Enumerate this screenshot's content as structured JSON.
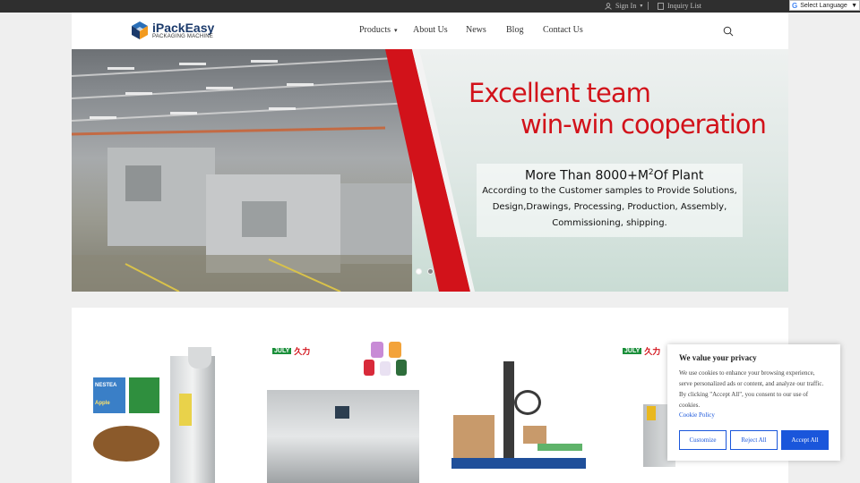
{
  "topbar": {
    "sign_in": "Sign In",
    "inquiry": "Inquiry List"
  },
  "language": {
    "label": "Select Language",
    "g": "G"
  },
  "header": {
    "brand": "iPackEasy",
    "brand_sub": "PACKAGING MACHINE",
    "nav": [
      "Products",
      "About Us",
      "News",
      "Blog",
      "Contact Us"
    ]
  },
  "hero": {
    "line1": "Excellent team",
    "line2": "win-win cooperation",
    "plant_prefix": "More Than 8000+M",
    "plant_sup": "2",
    "plant_suffix": "Of Plant",
    "desc1": "According to the Customer samples to Provide Solutions,",
    "desc2": "Design,Drawings, Processing, Production, Assembly,",
    "desc3": "Commissioning, shipping.",
    "slides": 2,
    "active_slide": 1
  },
  "products": {
    "card1": {
      "label1": "NESTEA",
      "label2": "Apple"
    },
    "brand_en": "JULY",
    "brand_cn": "久力"
  },
  "cookie": {
    "title": "We value your privacy",
    "body": "We use cookies to enhance your browsing experience, serve personalized ads or content, and analyze our traffic. By clicking \"Accept All\", you consent to our use of cookies.",
    "policy": "Cookie Policy",
    "customize": "Customize",
    "reject": "Reject All",
    "accept": "Accept All"
  },
  "colors": {
    "accent_red": "#d2121a",
    "link_blue": "#1a56db",
    "topbar": "#2f2f2f",
    "brand_navy": "#1b3a6b"
  }
}
